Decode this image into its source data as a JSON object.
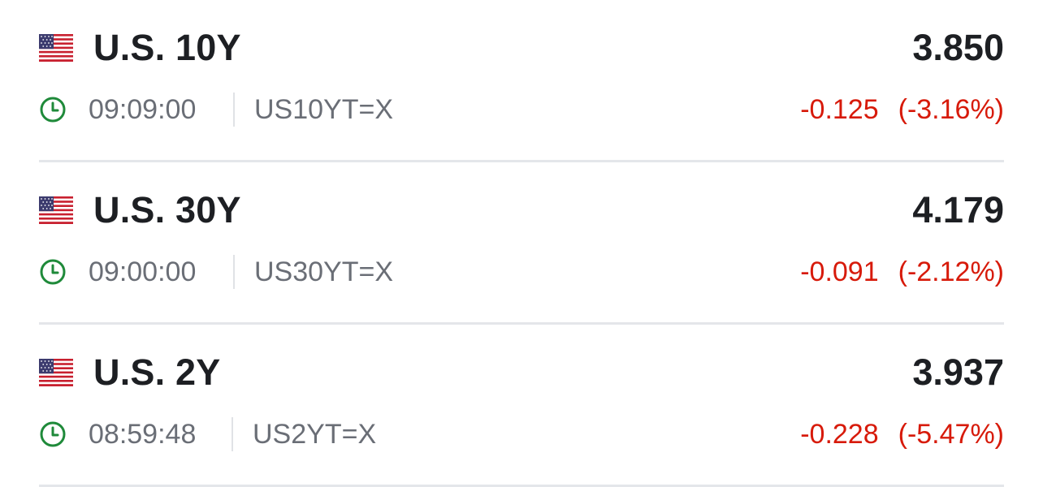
{
  "colors": {
    "negative": "#d71a0a",
    "positive_icon": "#1f8a3a",
    "text_primary": "#1d1f23",
    "text_secondary": "#6a6e76",
    "separator": "#e4e6ea"
  },
  "quotes": [
    {
      "flag_icon": "us-flag-icon",
      "name": "U.S. 10Y",
      "price": "3.850",
      "time": "09:09:00",
      "symbol": "US10YT=X",
      "change": "-0.125",
      "change_pct": "(-3.16%)"
    },
    {
      "flag_icon": "us-flag-icon",
      "name": "U.S. 30Y",
      "price": "4.179",
      "time": "09:00:00",
      "symbol": "US30YT=X",
      "change": "-0.091",
      "change_pct": "(-2.12%)"
    },
    {
      "flag_icon": "us-flag-icon",
      "name": "U.S. 2Y",
      "price": "3.937",
      "time": "08:59:48",
      "symbol": "US2YT=X",
      "change": "-0.228",
      "change_pct": "(-5.47%)"
    }
  ]
}
